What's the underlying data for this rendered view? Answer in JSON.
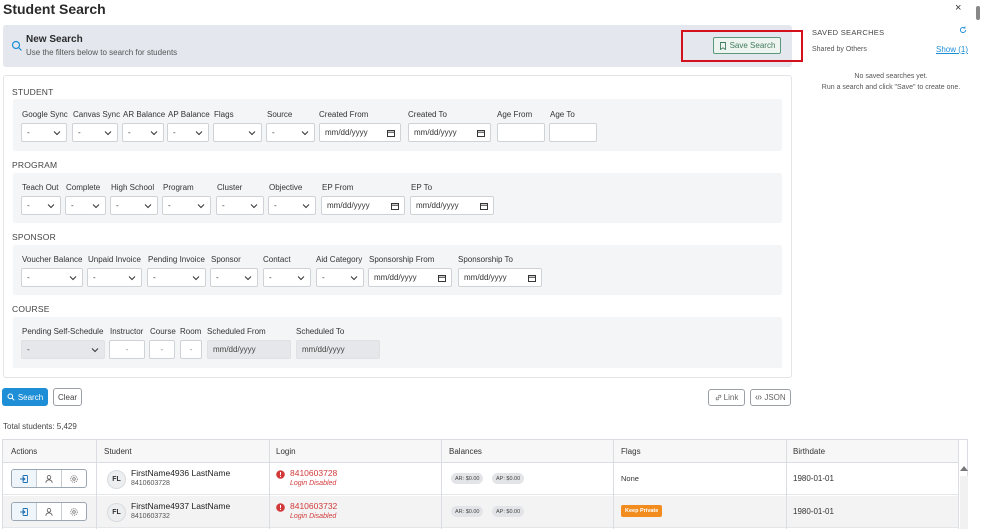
{
  "page": {
    "title": "Student Search",
    "close_label": "×"
  },
  "banner": {
    "title": "New Search",
    "subtitle": "Use the filters below to search for students",
    "save_label": "Save Search"
  },
  "sections": {
    "student": {
      "title": "STUDENT",
      "labels": [
        "Google Sync",
        "Canvas Sync",
        "AR Balance",
        "AP Balance",
        "Flags",
        "Source",
        "Created From",
        "Created To",
        "Age From",
        "Age To"
      ],
      "selects": [
        "-",
        "-",
        "-",
        "-",
        "",
        "-"
      ],
      "dates": [
        "mm/dd/yyyy",
        "mm/dd/yyyy"
      ]
    },
    "program": {
      "title": "PROGRAM",
      "labels": [
        "Teach Out",
        "Complete",
        "High School",
        "Program",
        "Cluster",
        "Objective",
        "EP From",
        "EP To"
      ],
      "selects": [
        "-",
        "-",
        "-",
        "-",
        "-",
        "-"
      ],
      "dates": [
        "mm/dd/yyyy",
        "mm/dd/yyyy"
      ]
    },
    "sponsor": {
      "title": "SPONSOR",
      "labels": [
        "Voucher Balance",
        "Unpaid Invoice",
        "Pending Invoice",
        "Sponsor",
        "Contact",
        "Aid Category",
        "Sponsorship From",
        "Sponsorship To"
      ],
      "selects": [
        "-",
        "-",
        "-",
        "-",
        "-",
        "-"
      ],
      "dates": [
        "mm/dd/yyyy",
        "mm/dd/yyyy"
      ]
    },
    "course": {
      "title": "COURSE",
      "labels": [
        "Pending Self-Schedule",
        "Instructor",
        "Course",
        "Room",
        "Scheduled From",
        "Scheduled To"
      ],
      "self_schedule": "-",
      "instructor": "-",
      "course": "-",
      "room": "-",
      "dates": [
        "mm/dd/yyyy",
        "mm/dd/yyyy"
      ]
    }
  },
  "actions": {
    "search": "Search",
    "clear": "Clear",
    "link": "Link",
    "json": "JSON"
  },
  "total": "Total students: 5,429",
  "table": {
    "headers": [
      "Actions",
      "Student",
      "Login",
      "Balances",
      "Flags",
      "Birthdate"
    ],
    "rows": [
      {
        "initials": "FL",
        "name": "FirstName4936 LastName",
        "id": "8410603728",
        "login": "8410603728",
        "login_status": "Login Disabled",
        "ar": "AR: $0.00",
        "ap": "AP: $0.00",
        "flag": "None",
        "birthdate": "1980-01-01"
      },
      {
        "initials": "FL",
        "name": "FirstName4937 LastName",
        "id": "8410603732",
        "login": "8410603732",
        "login_status": "Login Disabled",
        "ar": "AR: $0.00",
        "ap": "AP: $0.00",
        "flag": "Keep Private",
        "birthdate": "1980-01-01"
      }
    ]
  },
  "saved": {
    "title": "SAVED SEARCHES",
    "shared_label": "Shared by Others",
    "show_link": "Show (1)",
    "empty_line1": "No saved searches yet.",
    "empty_line2": "Run a search and click \"Save\" to create one."
  },
  "colors": {
    "primary": "#1e8fd6",
    "danger": "#d23a3a",
    "flag": "#f28c1e",
    "highlight": "#d4101c"
  },
  "icons": [
    "search-icon",
    "bookmark-icon",
    "close-icon",
    "refresh-icon",
    "chevron-down-icon",
    "calendar-icon",
    "link-icon",
    "code-icon",
    "login-as-icon",
    "user-icon",
    "settings-icon",
    "alert-icon"
  ]
}
